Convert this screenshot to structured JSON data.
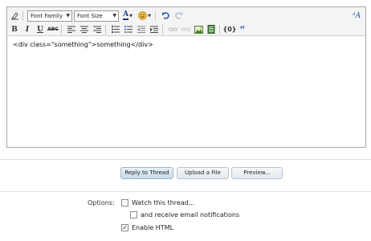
{
  "toolbar": {
    "font_family": "Font Family",
    "font_size": "Font Size",
    "icons_row1": [
      "remove-format-icon",
      "font-color-icon",
      "smiley-icon",
      "undo-icon",
      "redo-icon",
      "wysiwyg-toggle-icon"
    ],
    "icons_row2": [
      "bold-icon",
      "italic-icon",
      "underline-icon",
      "strikethrough-icon",
      "align-left-icon",
      "align-center-icon",
      "align-right-icon",
      "ordered-list-icon",
      "unordered-list-icon",
      "outdent-icon",
      "indent-icon",
      "link-icon",
      "unlink-icon",
      "image-icon",
      "media-icon",
      "code-icon",
      "quote-icon"
    ]
  },
  "editor": {
    "content": "<div class=\"something\">something</div>"
  },
  "buttons": {
    "reply": "Reply to Thread",
    "upload": "Upload a File",
    "preview": "Preview..."
  },
  "options": {
    "label": "Options:",
    "items": [
      {
        "label": "Watch this thread...",
        "checked": false
      },
      {
        "label": "and receive email notifications",
        "checked": false
      },
      {
        "label": "Enable HTML",
        "checked": true
      }
    ]
  },
  "colors": {
    "accent": "#c9dbea",
    "toolbar_bg": "#f4f4f4",
    "border": "#a8a8a8"
  }
}
